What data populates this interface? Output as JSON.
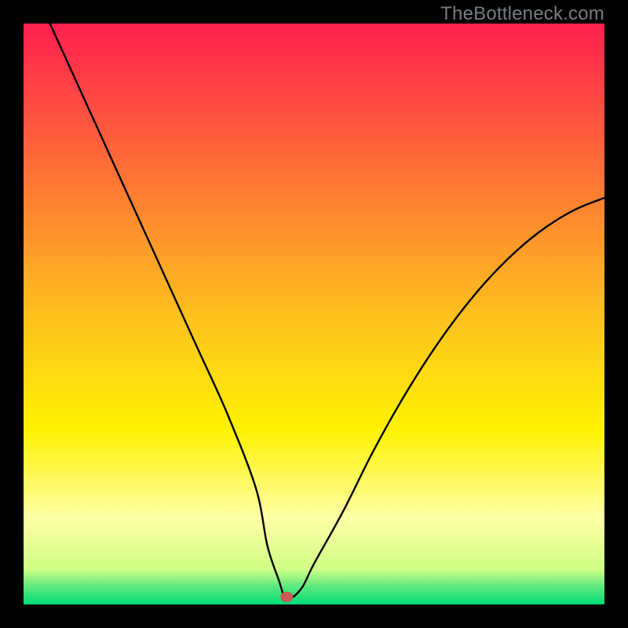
{
  "watermark": "TheBottleneck.com",
  "chart_data": {
    "type": "line",
    "title": "",
    "xlabel": "",
    "ylabel": "",
    "xlim": [
      0,
      100
    ],
    "ylim": [
      0,
      100
    ],
    "grid": false,
    "legend": false,
    "gradient_stops": [
      {
        "pos": 0.0,
        "color": "#FF1F50"
      },
      {
        "pos": 0.25,
        "color": "#FE6F37"
      },
      {
        "pos": 0.5,
        "color": "#FDC01D"
      },
      {
        "pos": 0.7,
        "color": "#FEF203"
      },
      {
        "pos": 0.85,
        "color": "#FFFFA5"
      },
      {
        "pos": 0.94,
        "color": "#D0FF85"
      },
      {
        "pos": 0.97,
        "color": "#5AE87D"
      },
      {
        "pos": 1.0,
        "color": "#00DC78"
      }
    ],
    "series": [
      {
        "name": "bottleneck-curve",
        "x": [
          0,
          5,
          10,
          15,
          20,
          25,
          30,
          35,
          40,
          42,
          44,
          45,
          46,
          48,
          50,
          55,
          60,
          65,
          70,
          75,
          80,
          85,
          90,
          95,
          100
        ],
        "values": [
          110,
          99,
          88,
          77,
          66,
          55,
          44,
          33,
          20,
          10,
          4,
          1,
          1,
          3,
          7,
          16,
          26,
          35,
          43,
          50,
          56,
          61,
          65,
          68,
          70
        ]
      }
    ],
    "marker": {
      "x": 45.3,
      "y": 1.3,
      "color": "#C95A55"
    }
  }
}
